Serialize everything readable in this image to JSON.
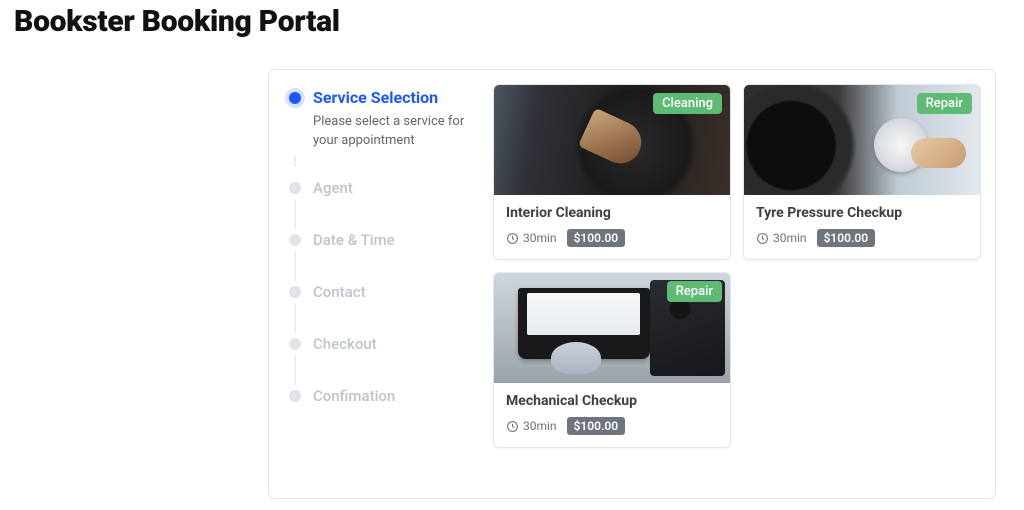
{
  "header": {
    "title": "Bookster Booking Portal"
  },
  "stepper": {
    "active_index": 0,
    "steps": [
      {
        "label": "Service Selection",
        "desc": "Please select a service for your appointment"
      },
      {
        "label": "Agent"
      },
      {
        "label": "Date & Time"
      },
      {
        "label": "Contact"
      },
      {
        "label": "Checkout"
      },
      {
        "label": "Confimation"
      }
    ]
  },
  "services": [
    {
      "title": "Interior Cleaning",
      "badge": "Cleaning",
      "duration": "30min",
      "price": "$100.00",
      "image": "interior-cleaning"
    },
    {
      "title": "Tyre Pressure Checkup",
      "badge": "Repair",
      "duration": "30min",
      "price": "$100.00",
      "image": "tyre-pressure"
    },
    {
      "title": "Mechanical Checkup",
      "badge": "Repair",
      "duration": "30min",
      "price": "$100.00",
      "image": "mechanical-checkup"
    }
  ],
  "colors": {
    "accent": "#1b57ff",
    "badge": "#5fbb73",
    "price_bg": "#6e757d"
  }
}
